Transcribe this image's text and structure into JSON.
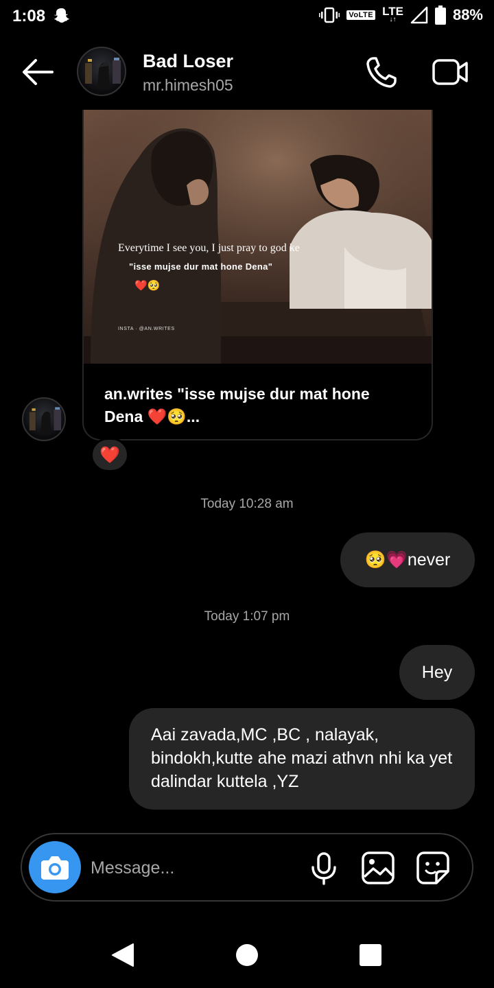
{
  "status_bar": {
    "time": "1:08",
    "volte": "VoLTE",
    "network": "LTE",
    "battery": "88%"
  },
  "header": {
    "name": "Bad Loser",
    "username": "mr.himesh05"
  },
  "shared_post": {
    "overlay_line1": "Everytime I see you, I just pray to god ke",
    "overlay_line2": "\"isse mujse dur mat hone Dena\"",
    "overlay_emoji": "❤️🥺",
    "overlay_credit": "INSTA · @AN.WRITES",
    "caption": "an.writes \"isse mujse dur mat hone Dena ❤️🥺...",
    "reaction": "❤️"
  },
  "messages": [
    {
      "type": "timestamp",
      "text": "Today 10:28 am"
    },
    {
      "type": "sent",
      "text": "🥺💗never"
    },
    {
      "type": "timestamp",
      "text": "Today 1:07 pm"
    },
    {
      "type": "sent",
      "text": "Hey"
    },
    {
      "type": "sent",
      "text": "Aai zavada,MC ,BC , nalayak, bindokh,kutte ahe mazi athvn nhi ka yet dalindar kuttela ,YZ"
    }
  ],
  "composer": {
    "placeholder": "Message..."
  },
  "icons": {
    "back": "arrow-left-icon",
    "call": "phone-icon",
    "video": "video-camera-icon",
    "camera": "camera-icon",
    "mic": "microphone-icon",
    "gallery": "image-icon",
    "sticker": "sticker-icon"
  },
  "colors": {
    "background": "#000000",
    "bubble": "#262626",
    "accent": "#3797f0",
    "secondary_text": "#a8a8a8"
  }
}
